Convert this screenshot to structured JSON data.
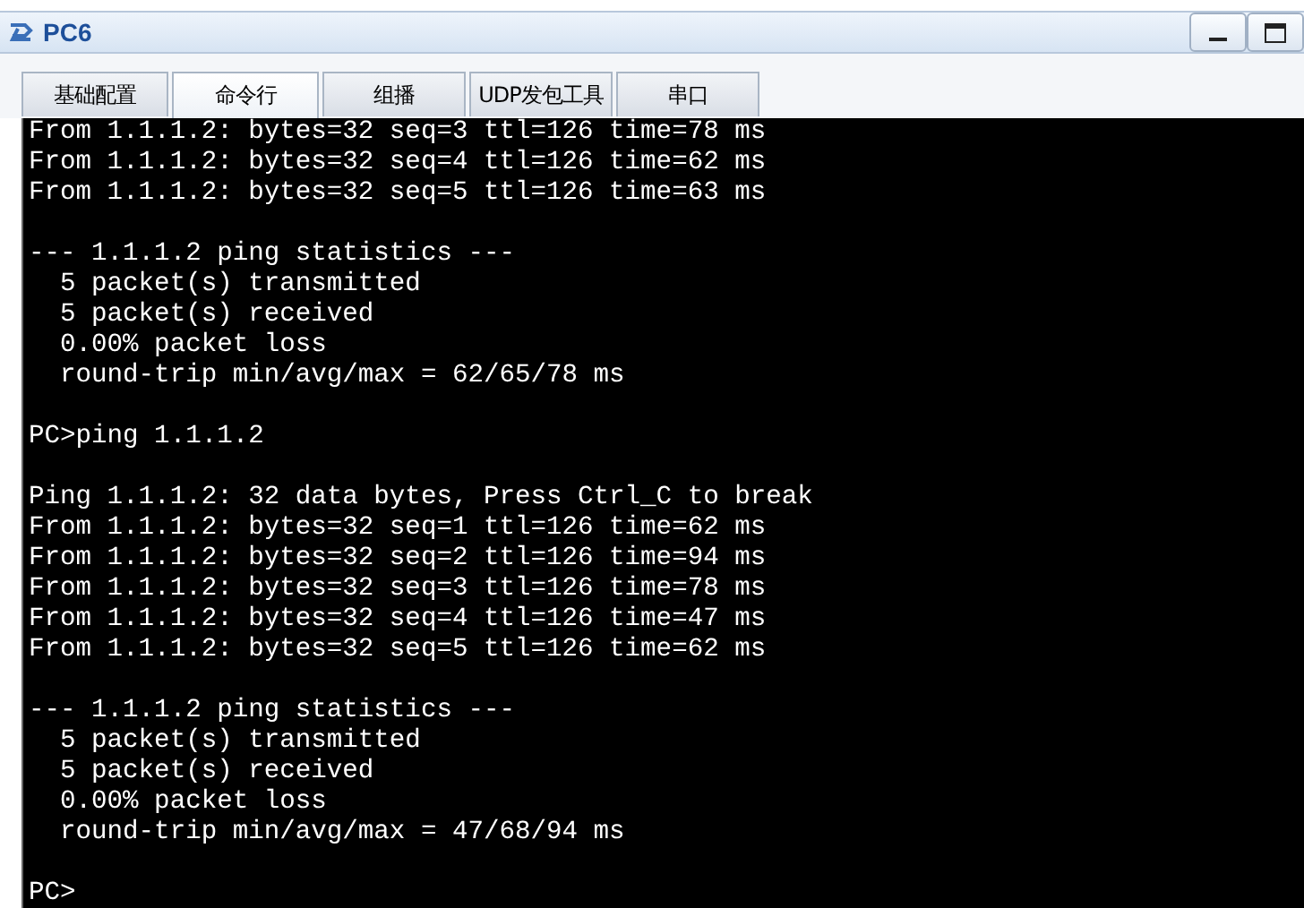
{
  "window": {
    "title": "PC6"
  },
  "tabs": [
    {
      "label": "基础配置",
      "selected": false
    },
    {
      "label": "命令行",
      "selected": true
    },
    {
      "label": "组播",
      "selected": false
    },
    {
      "label": "UDP发包工具",
      "selected": false
    },
    {
      "label": "串口",
      "selected": false
    }
  ],
  "terminal": {
    "blocks": [
      [
        "From 1.1.1.2: bytes=32 seq=3 ttl=126 time=78 ms",
        "From 1.1.1.2: bytes=32 seq=4 ttl=126 time=62 ms",
        "From 1.1.1.2: bytes=32 seq=5 ttl=126 time=63 ms"
      ],
      [
        "--- 1.1.1.2 ping statistics ---",
        "  5 packet(s) transmitted",
        "  5 packet(s) received",
        "  0.00% packet loss",
        "  round-trip min/avg/max = 62/65/78 ms"
      ],
      [
        "PC>ping 1.1.1.2"
      ],
      [
        "Ping 1.1.1.2: 32 data bytes, Press Ctrl_C to break",
        "From 1.1.1.2: bytes=32 seq=1 ttl=126 time=62 ms",
        "From 1.1.1.2: bytes=32 seq=2 ttl=126 time=94 ms",
        "From 1.1.1.2: bytes=32 seq=3 ttl=126 time=78 ms",
        "From 1.1.1.2: bytes=32 seq=4 ttl=126 time=47 ms",
        "From 1.1.1.2: bytes=32 seq=5 ttl=126 time=62 ms"
      ],
      [
        "--- 1.1.1.2 ping statistics ---",
        "  5 packet(s) transmitted",
        "  5 packet(s) received",
        "  0.00% packet loss",
        "  round-trip min/avg/max = 47/68/94 ms"
      ],
      [
        "PC>"
      ]
    ]
  }
}
